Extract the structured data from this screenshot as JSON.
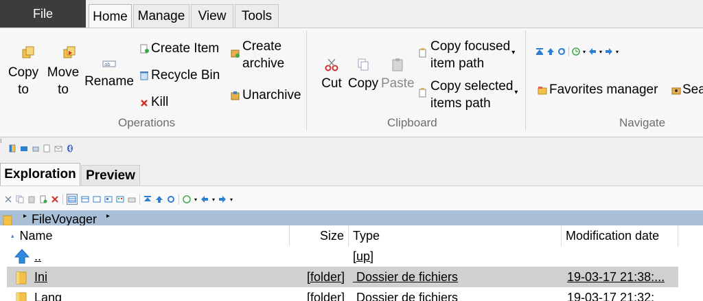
{
  "tabs": {
    "file": "File",
    "home": "Home",
    "manage": "Manage",
    "view": "View",
    "tools": "Tools"
  },
  "ribbon": {
    "operations": {
      "label": "Operations",
      "copy_to": [
        "Copy",
        "to"
      ],
      "move_to": [
        "Move",
        "to"
      ],
      "rename": "Rename",
      "create_item": "Create Item",
      "recycle_bin": "Recycle Bin",
      "kill": "Kill",
      "create_archive": [
        "Create",
        "archive"
      ],
      "unarchive": "Unarchive"
    },
    "clipboard": {
      "label": "Clipboard",
      "cut": "Cut",
      "copy": "Copy",
      "paste": "Paste",
      "copy_focused": [
        "Copy focused",
        "item path"
      ],
      "copy_selected": [
        "Copy selected",
        "items path"
      ]
    },
    "navigate": {
      "label": "Navigate",
      "favorites": "Favorites manager",
      "search": "Sea"
    }
  },
  "subtabs": {
    "exploration": "Exploration",
    "preview": "Preview"
  },
  "path": {
    "crumb": "FileVoyager"
  },
  "columns": {
    "name": "Name",
    "size": "Size",
    "type": "Type",
    "date": "Modification date"
  },
  "rows": [
    {
      "name": "..",
      "size": "",
      "type": "[up]",
      "date": ""
    },
    {
      "name": "Ini",
      "size": "[folder]",
      "type": " Dossier de fichiers",
      "date": "19-03-17 21:38:..."
    },
    {
      "name": "Lang",
      "size": "[folder]",
      "type": " Dossier de fichiers",
      "date": "19-03-17 21:32:"
    }
  ],
  "colors": {
    "file_tab_bg": "#3c3c3c",
    "selected_row": "#d0d0d0",
    "path_bar": "#a9bfd6",
    "folder": "#f3c14a",
    "up_arrow": "#2f8be0",
    "kill_red": "#d0312d"
  }
}
